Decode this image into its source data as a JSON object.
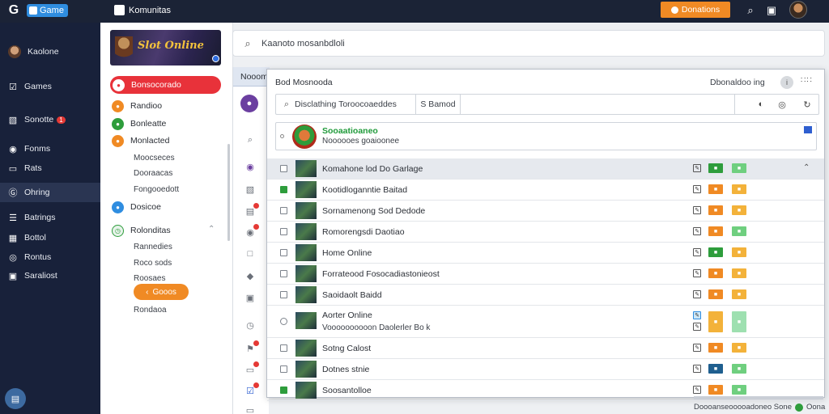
{
  "colors": {
    "topbar_bg": "#1b2336",
    "nav_bg": "#18213a",
    "accent_orange": "#f08a24",
    "accent_red": "#e8323a",
    "accent_green": "#2e9d3c",
    "accent_blue": "#2f8de0"
  },
  "topbar": {
    "brand_label": "Game",
    "breadcrumb": "Komunitas",
    "cta_label": "Donations",
    "icons": [
      "search-icon",
      "notification-icon",
      "profile-avatar"
    ]
  },
  "nav": {
    "profile": "Kaolone",
    "items": [
      {
        "label": "Games",
        "icon": "checkbox-icon"
      },
      {
        "label": "Sonotte",
        "icon": "image-icon",
        "badge": "1"
      },
      {
        "label": "Fonms",
        "icon": "camera-icon"
      },
      {
        "label": "Rats",
        "icon": "card-icon"
      },
      {
        "label": "Ohring",
        "icon": "g-icon",
        "active": true
      },
      {
        "label": "Batrings",
        "icon": "list-icon"
      },
      {
        "label": "Bottol",
        "icon": "grid-icon"
      },
      {
        "label": "Rontus",
        "icon": "target-icon"
      },
      {
        "label": "Saraliost",
        "icon": "lock-icon"
      }
    ]
  },
  "sidebar": {
    "banner_text": "Slot Online",
    "items": [
      {
        "label": "Bonsocorado",
        "color": "#e8323a",
        "highlight": true
      },
      {
        "label": "Randioo",
        "color": "#f08a24"
      },
      {
        "label": "Bonleatte",
        "color": "#2e9d3c"
      },
      {
        "label": "Monlacted",
        "color": "#f08a24"
      }
    ],
    "sub_items_1": [
      "Moocseces",
      "Dooraacas",
      "Fongooedott"
    ],
    "item_blue": {
      "label": "Dosicoe",
      "color": "#2f8de0"
    },
    "group": {
      "label": "Rolonditas",
      "color": "#2e9d3c"
    },
    "sub_items_2": [
      "Rannedies",
      "Roco sods",
      "Roosaes"
    ],
    "pill_label": "Gooos",
    "last_item": "Rondaoa"
  },
  "search": {
    "placeholder": "Kaanoto mosanbdloli"
  },
  "backpanel": {
    "header": "Nooomoe"
  },
  "dialog": {
    "title": "Bod Mosnooda",
    "right_text": "Dbonaldoo ing",
    "filter_text": "Disclathing Toroocoaeddes",
    "filter_button": "S Bamod",
    "featured": {
      "title": "Sooaatioaneo",
      "subtitle": "Noooooes goaioonee"
    },
    "rows": [
      {
        "name": "Komahone lod Do Garlage",
        "checked": false,
        "badge1": "#2e9d3c",
        "badge2": "#6fcf7f",
        "selected": true,
        "caret": true
      },
      {
        "name": "Kootidloganntie Baitad",
        "checked": true,
        "badge1": "#f08a24",
        "badge2": "#f3b23a"
      },
      {
        "name": "Sornamenong Sod Dedode",
        "checked": false,
        "badge1": "#f08a24",
        "badge2": "#f3b23a"
      },
      {
        "name": "Romorengsdi Daotiao",
        "checked": false,
        "badge1": "#f08a24",
        "badge2": "#6fcf7f"
      },
      {
        "name": "Home Online",
        "checked": false,
        "badge1": "#2e9d3c",
        "badge2": "#f3b23a"
      },
      {
        "name": "Forrateood Fosocadiastonieost",
        "checked": false,
        "badge1": "#f08a24",
        "badge2": "#f3b23a"
      },
      {
        "name": "Saoidaolt Baidd",
        "checked": false,
        "badge1": "#f08a24",
        "badge2": "#f3b23a"
      },
      {
        "name": "Aorter Online",
        "subtitle": "Voooooooooon Daolerler Bo k",
        "radio": true,
        "tall": true,
        "badge1": "#f3b23a",
        "badge2": "#9ee0b0"
      },
      {
        "name": "Sotng Calost",
        "checked": false,
        "badge1": "#f08a24",
        "badge2": "#f3b23a"
      },
      {
        "name": "Dotnes stnie",
        "checked": false,
        "badge1": "#1f5f8f",
        "badge2": "#6fcf7f"
      },
      {
        "name": "Soosantolloe",
        "checked": true,
        "badge1": "#f08a24",
        "badge2": "#6fcf7f"
      }
    ]
  },
  "status": {
    "text": "Doooanseooooadoneo Sone",
    "right": "Oona"
  }
}
